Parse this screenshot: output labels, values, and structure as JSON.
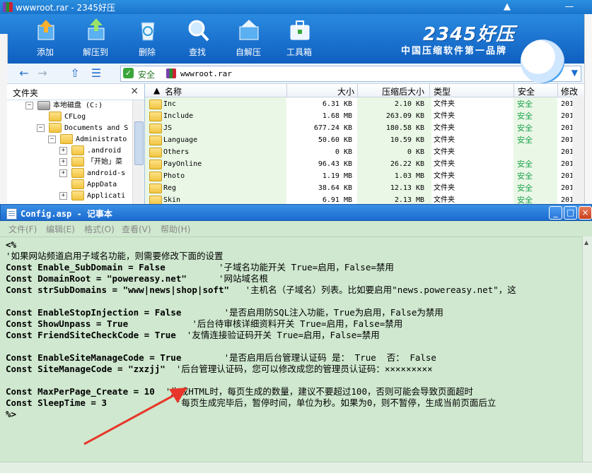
{
  "archive": {
    "title": "wwwroot.rar - 2345好压",
    "window_controls": [
      "▲",
      "—"
    ],
    "toolbar": [
      {
        "label": "添加",
        "icon": "add-archive-icon"
      },
      {
        "label": "解压到",
        "icon": "extract-to-icon"
      },
      {
        "label": "删除",
        "icon": "recycle-bin-icon"
      },
      {
        "label": "查找",
        "icon": "magnifier-icon"
      },
      {
        "label": "自解压",
        "icon": "self-extract-icon"
      },
      {
        "label": "工具箱",
        "icon": "toolbox-icon"
      }
    ],
    "brand": {
      "logo": "2345好压",
      "slogan": "中国压缩软件第一品牌"
    },
    "address": {
      "safe_label": "安全",
      "path": "wwwroot.rar"
    },
    "tree": {
      "header": "文件夹",
      "close": "×",
      "items": [
        {
          "label": "本地磁盘 (C:)",
          "exp": "−",
          "indent": 0,
          "kind": "drive"
        },
        {
          "label": "CFLog",
          "exp": "",
          "indent": 1,
          "kind": "folder"
        },
        {
          "label": "Documents and S",
          "exp": "−",
          "indent": 1,
          "kind": "folder"
        },
        {
          "label": "Administrato",
          "exp": "−",
          "indent": 2,
          "kind": "folder"
        },
        {
          "label": ".android",
          "exp": "+",
          "indent": 3,
          "kind": "folder"
        },
        {
          "label": "「开始」菜",
          "exp": "+",
          "indent": 3,
          "kind": "folder"
        },
        {
          "label": "android-s",
          "exp": "+",
          "indent": 3,
          "kind": "folder"
        },
        {
          "label": "AppData",
          "exp": "",
          "indent": 3,
          "kind": "folder"
        },
        {
          "label": "Applicati",
          "exp": "+",
          "indent": 3,
          "kind": "folder"
        }
      ]
    },
    "files": {
      "columns": [
        "名称",
        "大小",
        "压缩后大小",
        "类型",
        "安全",
        "修改"
      ],
      "rows": [
        {
          "name": "Inc",
          "size": "6.31 KB",
          "csize": "2.10 KB",
          "type": "文件夹",
          "sec": "安全",
          "mod": "201"
        },
        {
          "name": "Include",
          "size": "1.68 MB",
          "csize": "263.09 KB",
          "type": "文件夹",
          "sec": "安全",
          "mod": "201"
        },
        {
          "name": "JS",
          "size": "677.24 KB",
          "csize": "180.58 KB",
          "type": "文件夹",
          "sec": "安全",
          "mod": "201"
        },
        {
          "name": "Language",
          "size": "50.60 KB",
          "csize": "10.59 KB",
          "type": "文件夹",
          "sec": "安全",
          "mod": "201"
        },
        {
          "name": "Others",
          "size": "0 KB",
          "csize": "0 KB",
          "type": "文件夹",
          "sec": "",
          "mod": "201"
        },
        {
          "name": "PayOnline",
          "size": "96.43 KB",
          "csize": "26.22 KB",
          "type": "文件夹",
          "sec": "安全",
          "mod": "201"
        },
        {
          "name": "Photo",
          "size": "1.19 MB",
          "csize": "1.03 MB",
          "type": "文件夹",
          "sec": "安全",
          "mod": "201"
        },
        {
          "name": "Reg",
          "size": "38.64 KB",
          "csize": "12.13 KB",
          "type": "文件夹",
          "sec": "安全",
          "mod": "201"
        },
        {
          "name": "Skin",
          "size": "6.91 MB",
          "csize": "2.13 MB",
          "type": "文件夹",
          "sec": "安全",
          "mod": "201"
        }
      ]
    }
  },
  "notepad": {
    "title": "Config.asp - 记事本",
    "menus": [
      "文件(F)",
      "编辑(E)",
      "格式(O)",
      "查看(V)",
      "帮助(H)"
    ],
    "lines": [
      {
        "code": "<%",
        "comment": ""
      },
      {
        "code": "",
        "comment": "'如果网站频道启用子域名功能，则需要修改下面的设置"
      },
      {
        "code": "Const Enable_SubDomain = False          ",
        "comment": "'子域名功能开关 True=启用，False=禁用"
      },
      {
        "code": "Const DomainRoot = \"powereasy.net\"      ",
        "comment": "'网站域名根"
      },
      {
        "code": "Const strSubDomains = \"www|news|shop|soft\"   ",
        "comment": "'主机名（子域名）列表。比如要启用\"news.powereasy.net\"，这"
      },
      {
        "code": "",
        "comment": ""
      },
      {
        "code": "Const EnableStopInjection = False        ",
        "comment": "'是否启用防SQL注入功能，True为启用，False为禁用"
      },
      {
        "code": "Const ShowUnpass = True            ",
        "comment": "'后台待审核详细资料开关 True=启用，False=禁用"
      },
      {
        "code": "Const FriendSiteCheckCode = True  ",
        "comment": "'友情连接验证码开关 True=启用，False=禁用"
      },
      {
        "code": "",
        "comment": ""
      },
      {
        "code": "Const EnableSiteManageCode = True        ",
        "comment": "'是否启用后台管理认证码 是： True  否： False"
      },
      {
        "code": "Const SiteManageCode = \"zxzjj\"  ",
        "comment": "'后台管理认证码，您可以修改成您的管理员认证码：×××××××××"
      },
      {
        "code": "",
        "comment": ""
      },
      {
        "code": "Const MaxPerPage_Create = 10  ",
        "comment": "'生成HTML时，每页生成的数量，建议不要超过100，否则可能会导致页面超时"
      },
      {
        "code": "Const SleepTime = 3             ",
        "comment": "'每页生成完毕后，暂停时间，单位为秒。如果为0，则不暂停，生成当前页面后立"
      },
      {
        "code": "%>",
        "comment": ""
      }
    ],
    "controls": [
      "_",
      "□",
      "×"
    ]
  },
  "colors": {
    "arrow": "#e8362a",
    "notepad_bg": "#cfe8cf",
    "toolbar_blue": "#1a74cc",
    "safe_green": "#1aa34a"
  }
}
